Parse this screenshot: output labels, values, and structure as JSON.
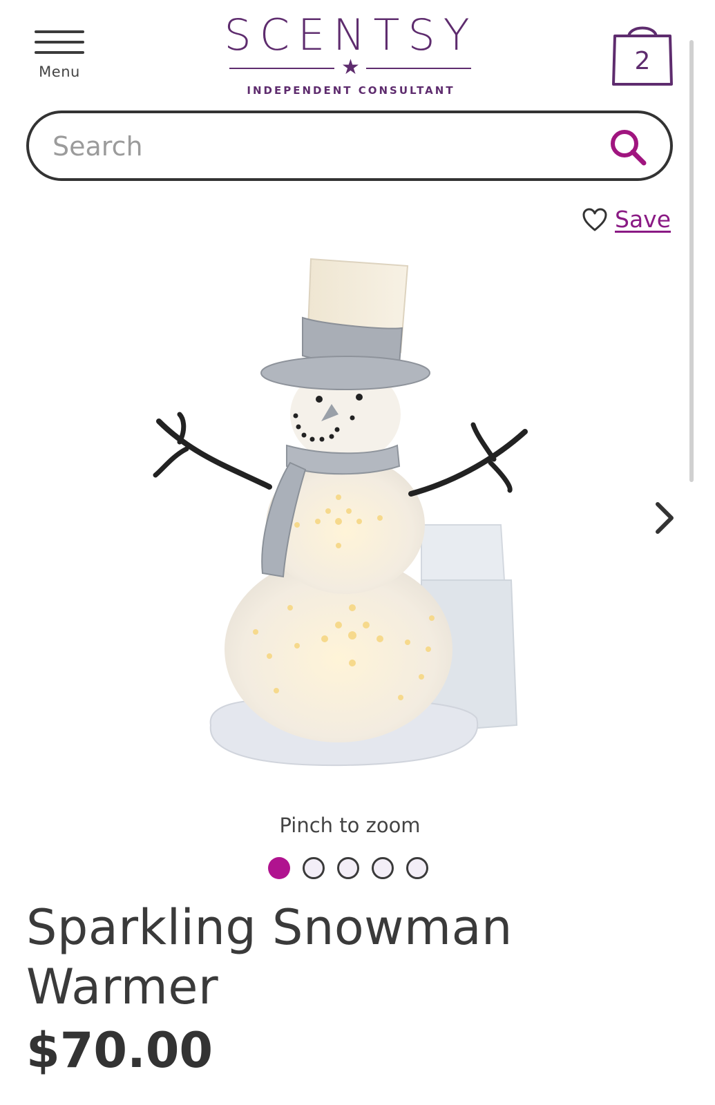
{
  "header": {
    "menu_label": "Menu",
    "logo": {
      "wordmark": "SCENTSY",
      "tagline": "INDEPENDENT CONSULTANT",
      "accent_color": "#5e2c6e"
    },
    "cart": {
      "count": "2",
      "icon": "shopping-bag-icon"
    }
  },
  "search": {
    "placeholder": "Search",
    "value": "",
    "icon": "search-icon",
    "icon_color": "#a0157f"
  },
  "product": {
    "save_label": "Save",
    "save_icon": "heart-outline-icon",
    "image_subject": "snowman warmer product photo",
    "zoom_hint": "Pinch to zoom",
    "gallery": {
      "total_images": 5,
      "active_index": 0,
      "active_color": "#b0138f"
    },
    "title": "Sparkling Snowman Warmer",
    "price": "$70.00"
  }
}
